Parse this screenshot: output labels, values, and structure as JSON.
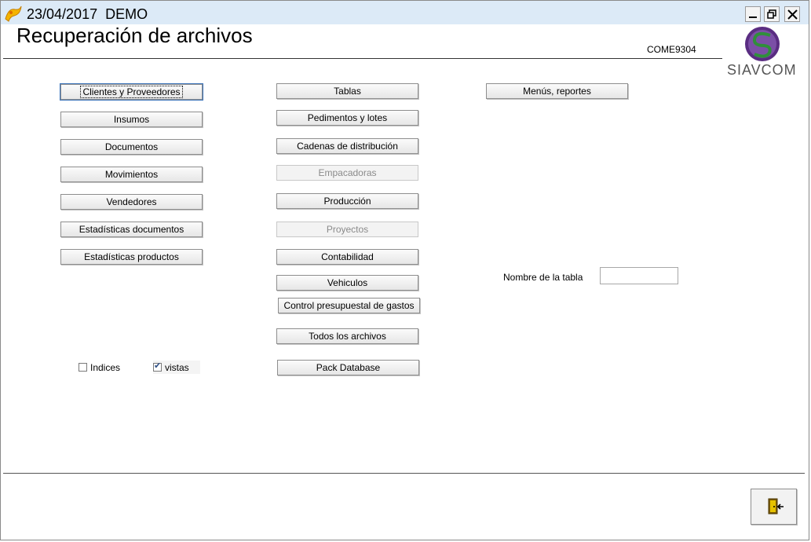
{
  "titlebar": {
    "title": "23/04/2017  DEMO"
  },
  "header": {
    "heading": "Recuperación de archivos",
    "code": "COME9304",
    "logo_text": "SIAVCOM"
  },
  "column1": [
    {
      "label": "Clientes y Proveedores",
      "focused": true
    },
    {
      "label": "Insumos"
    },
    {
      "label": "Documentos"
    },
    {
      "label": "Movimientos"
    },
    {
      "label": "Vendedores"
    },
    {
      "label": "Estadísticas documentos"
    },
    {
      "label": "Estadísticas productos"
    }
  ],
  "column2": [
    {
      "label": "Tablas"
    },
    {
      "label": "Pedimentos y lotes"
    },
    {
      "label": "Cadenas de distribución"
    },
    {
      "label": "Empacadoras",
      "disabled": true
    },
    {
      "label": "Producción"
    },
    {
      "label": "Proyectos",
      "disabled": true
    },
    {
      "label": "Contabilidad"
    },
    {
      "label": "Vehiculos"
    },
    {
      "label": "Control presupuestal de gastos"
    },
    {
      "label": "Todos los archivos"
    },
    {
      "label": "Pack Database"
    }
  ],
  "column3": [
    {
      "label": "Menús, reportes"
    }
  ],
  "checkboxes": [
    {
      "label": "Indices",
      "checked": false
    },
    {
      "label": "vistas",
      "checked": true
    }
  ],
  "table_name": {
    "label": "Nombre de la tabla",
    "value": ""
  },
  "icons": {
    "app": "app-logo-icon",
    "minimize": "minimize-icon",
    "restore": "restore-icon",
    "close": "close-icon",
    "exit": "exit-door-icon"
  },
  "colors": {
    "titlebar": "#dceaf7",
    "logo_purple": "#5a2d82",
    "logo_green": "#2f8f3a"
  }
}
